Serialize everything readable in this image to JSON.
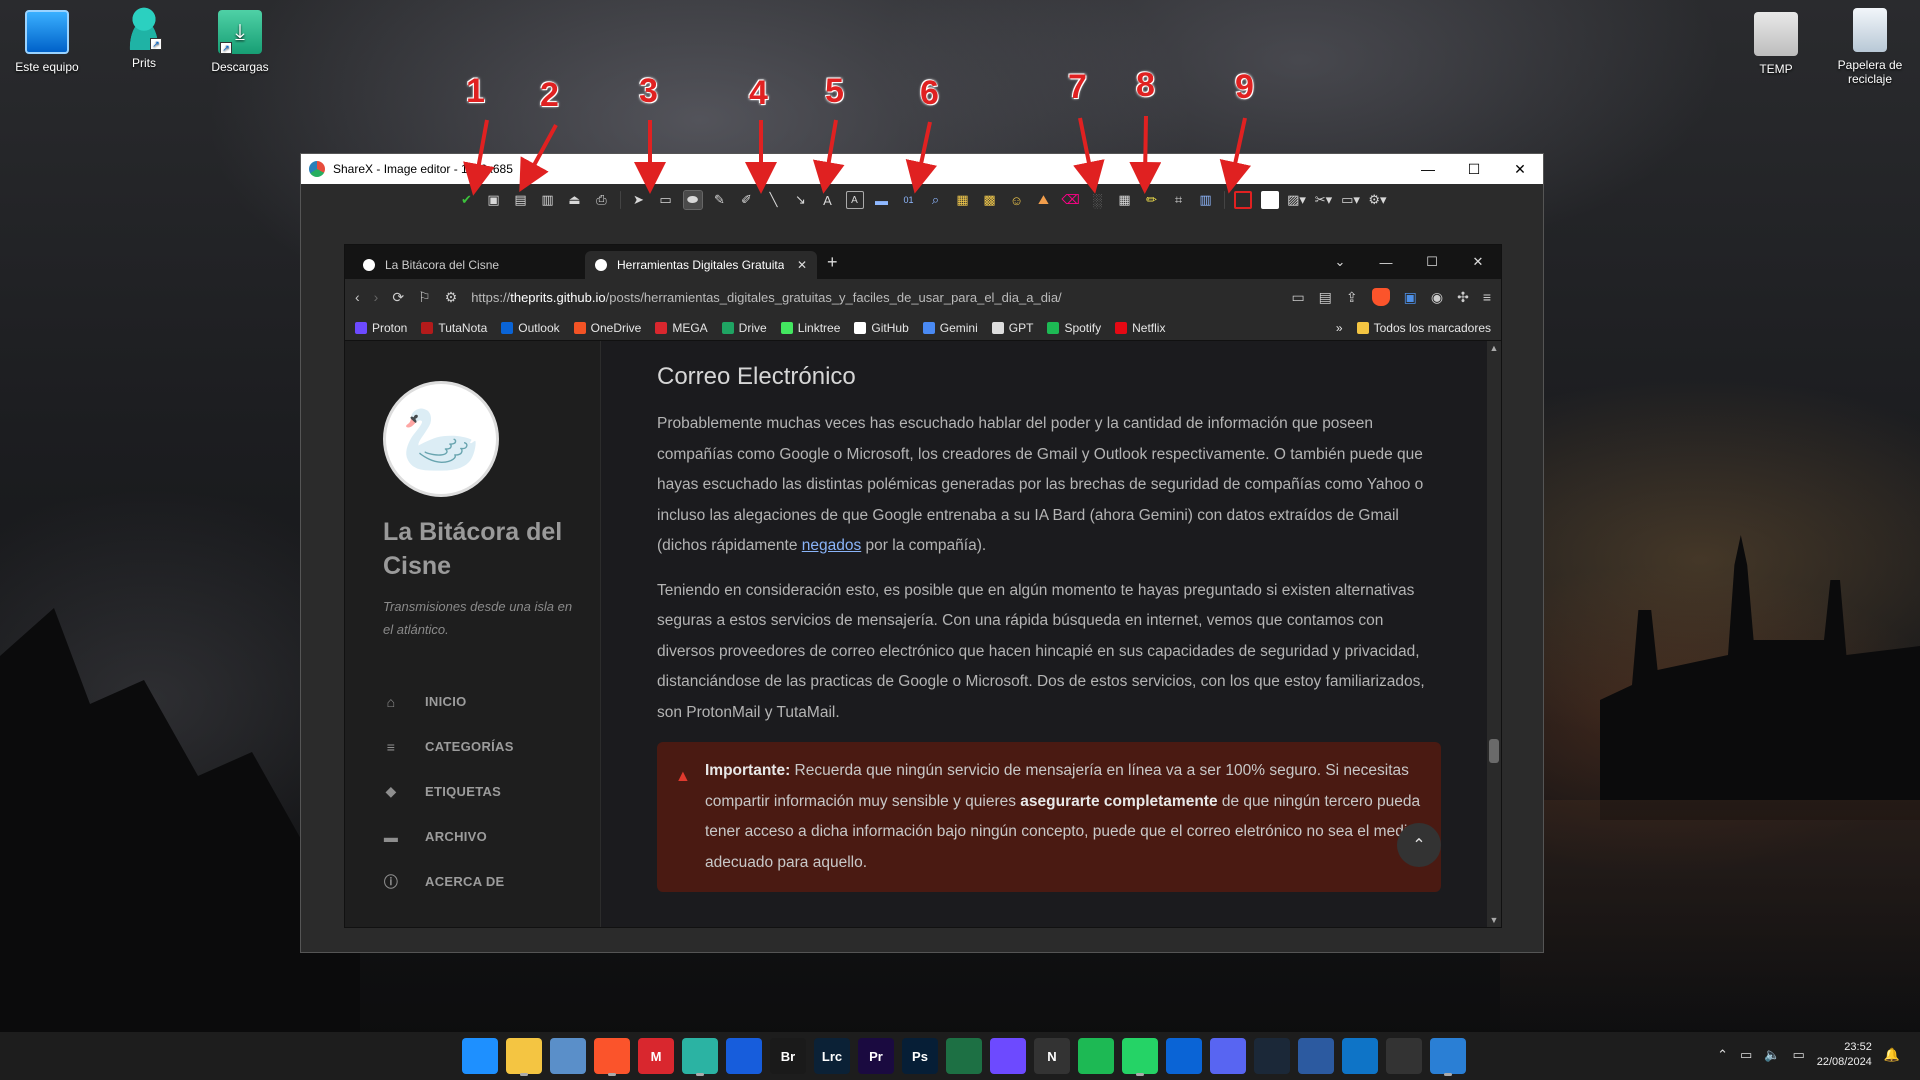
{
  "desktop": {
    "icons_left": [
      {
        "label": "Este equipo",
        "icon": "computer-icon"
      },
      {
        "label": "Prits",
        "icon": "user-folder-icon"
      },
      {
        "label": "Descargas",
        "icon": "downloads-icon"
      }
    ],
    "icons_right": [
      {
        "label": "TEMP",
        "icon": "folder-icon"
      },
      {
        "label": "Papelera de reciclaje",
        "icon": "recycle-bin-icon"
      }
    ]
  },
  "annotations": [
    "1",
    "2",
    "3",
    "4",
    "5",
    "6",
    "7",
    "8",
    "9"
  ],
  "sharex": {
    "title": "ShareX - Image editor - 1126x685",
    "toolbar_icons": [
      "check-icon",
      "save-icon",
      "save-as-icon",
      "copy-icon",
      "upload-icon",
      "print-icon",
      "cursor-icon",
      "rectangle-icon",
      "ellipse-icon",
      "freehand-icon",
      "smart-eraser-icon",
      "line-icon",
      "arrow-icon",
      "text-icon",
      "text-background-icon",
      "speech-balloon-icon",
      "step-icon",
      "magnify-icon",
      "sticker-icon",
      "cursor-sticker-icon",
      "emoji-icon",
      "image-icon",
      "eraser-icon",
      "blur-icon",
      "pixelate-icon",
      "highlight-icon",
      "crop-icon",
      "cut-out-icon",
      "border-color-icon",
      "fill-color-icon",
      "shape-options-icon",
      "tools-icon",
      "upload-options-icon",
      "settings-icon"
    ],
    "accent": "#e02121"
  },
  "browser": {
    "tabs": [
      {
        "label": "La Bitácora del Cisne",
        "active": false
      },
      {
        "label": "Herramientas Digitales Gratuita",
        "active": true
      }
    ],
    "url_prefix": "https://",
    "url_host": "theprits.github.io",
    "url_path": "/posts/herramientas_digitales_gratuitas_y_faciles_de_usar_para_el_dia_a_dia/",
    "bookmarks": [
      {
        "label": "Proton",
        "color": "#6d4aff"
      },
      {
        "label": "TutaNota",
        "color": "#b31b1b"
      },
      {
        "label": "Outlook",
        "color": "#0a64d6"
      },
      {
        "label": "OneDrive",
        "color": "#f35325"
      },
      {
        "label": "MEGA",
        "color": "#d9272e"
      },
      {
        "label": "Drive",
        "color": "#1fa463"
      },
      {
        "label": "Linktree",
        "color": "#43e660"
      },
      {
        "label": "GitHub",
        "color": "#ffffff"
      },
      {
        "label": "Gemini",
        "color": "#4a8af4"
      },
      {
        "label": "GPT",
        "color": "#dddddd"
      },
      {
        "label": "Spotify",
        "color": "#1db954"
      },
      {
        "label": "Netflix",
        "color": "#e50914"
      }
    ],
    "all_bookmarks": "Todos los marcadores"
  },
  "site": {
    "title": "La Bitácora del Cisne",
    "subtitle": "Transmisiones desde una isla en el atlántico.",
    "nav": [
      {
        "label": "INICIO",
        "icon": "home-icon"
      },
      {
        "label": "CATEGORÍAS",
        "icon": "list-icon"
      },
      {
        "label": "ETIQUETAS",
        "icon": "tags-icon"
      },
      {
        "label": "ARCHIVO",
        "icon": "archive-icon"
      },
      {
        "label": "ACERCA DE",
        "icon": "info-icon"
      }
    ]
  },
  "article": {
    "heading": "Correo Electrónico",
    "p1_before": "Probablemente muchas veces has escuchado hablar del poder y la cantidad de información que poseen compañías como Google o Microsoft, los creadores de Gmail y Outlook respectivamente. O también puede que hayas escuchado las distintas polémicas generadas por las brechas de seguridad de compañías como Yahoo o incluso las alegaciones de que Google entrenaba a su IA Bard (ahora Gemini) con datos extraídos de Gmail (dichos rápidamente ",
    "p1_link": "negados",
    "p1_after": " por la compañía).",
    "p2": "Teniendo en consideración esto, es posible que en algún momento te hayas preguntado si existen alternativas seguras a estos servicios de mensajería. Con una rápida búsqueda en internet, vemos que contamos con diversos proveedores de correo electrónico que hacen hincapié en sus capacidades de seguridad y privacidad, distanciándose de las practicas de Google o Microsoft. Dos de estos servicios, con los que estoy familiarizados, son ProtonMail y TutaMail.",
    "callout_label": "Importante:",
    "callout_a": " Recuerda que ningún servicio de mensajería en línea va a ser 100% seguro. Si necesitas compartir información muy sensible y quieres ",
    "callout_bold": "asegurarte completamente",
    "callout_b": " de que ningún tercero pueda tener acceso a dicha información bajo ningún concepto, puede que el correo eletrónico no sea el medio adecuado para aquello."
  },
  "taskbar": {
    "apps": [
      {
        "icon": "windows-start-icon",
        "label": "",
        "color": "#1e90ff"
      },
      {
        "icon": "file-explorer-icon",
        "label": "",
        "color": "#f4c542"
      },
      {
        "icon": "photos-icon",
        "label": "",
        "color": "#5a8fc9"
      },
      {
        "icon": "brave-icon",
        "label": "",
        "color": "#fb542b"
      },
      {
        "icon": "mega-icon",
        "label": "M",
        "color": "#d9272e"
      },
      {
        "icon": "user-icon",
        "label": "",
        "color": "#2bb3a3"
      },
      {
        "icon": "bitwarden-icon",
        "label": "",
        "color": "#175ddc"
      },
      {
        "icon": "bridge-icon",
        "label": "Br",
        "color": "#1a1a1a"
      },
      {
        "icon": "lightroom-classic-icon",
        "label": "Lrc",
        "color": "#0b2136"
      },
      {
        "icon": "premiere-icon",
        "label": "Pr",
        "color": "#1a0a40"
      },
      {
        "icon": "photoshop-icon",
        "label": "Ps",
        "color": "#061e36"
      },
      {
        "icon": "excel-icon",
        "label": "",
        "color": "#1d7044"
      },
      {
        "icon": "proton-icon",
        "label": "",
        "color": "#6d4aff"
      },
      {
        "icon": "notion-icon",
        "label": "N",
        "color": "#333333"
      },
      {
        "icon": "spotify-icon",
        "label": "",
        "color": "#1db954"
      },
      {
        "icon": "whatsapp-icon",
        "label": "",
        "color": "#25d366"
      },
      {
        "icon": "outlook-icon",
        "label": "",
        "color": "#0a64d6"
      },
      {
        "icon": "discord-icon",
        "label": "",
        "color": "#5865f2"
      },
      {
        "icon": "steam-icon",
        "label": "",
        "color": "#1b2838"
      },
      {
        "icon": "powershell-icon",
        "label": "",
        "color": "#2c5aa0"
      },
      {
        "icon": "vscode-icon",
        "label": "",
        "color": "#0e74c7"
      },
      {
        "icon": "media-player-icon",
        "label": "",
        "color": "#333333"
      },
      {
        "icon": "sharex-icon",
        "label": "",
        "color": "#2a7fd5"
      }
    ],
    "time": "23:52",
    "date": "22/08/2024"
  }
}
